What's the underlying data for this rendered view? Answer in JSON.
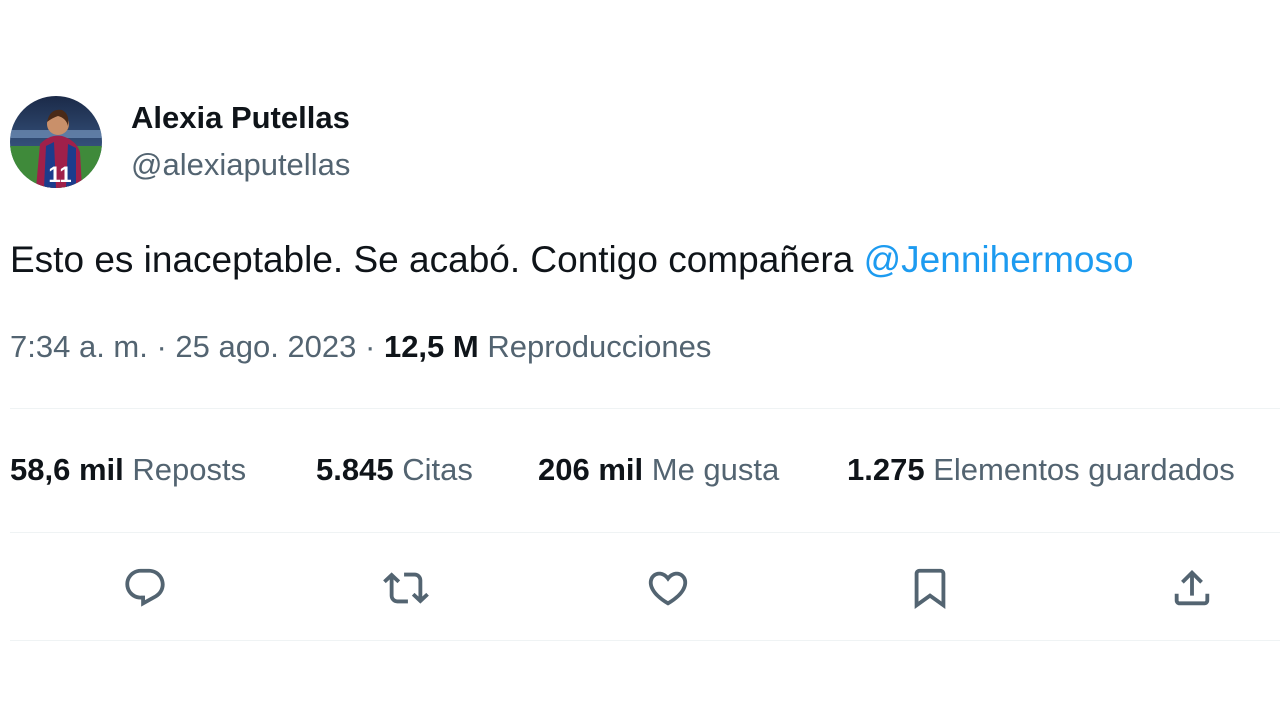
{
  "author": {
    "display_name": "Alexia Putellas",
    "handle": "@alexiaputellas",
    "avatar_icon": "avatar-photo"
  },
  "tweet": {
    "text": "Esto es inaceptable. Se acabó. Contigo compañera ",
    "mention": "@Jennihermoso",
    "time": "7:34 a. m. · 25 ago. 2023 · ",
    "views_count": "12,5 M",
    "views_label": " Reproducciones"
  },
  "stats": [
    {
      "count": "58,6 mil",
      "label": "Reposts"
    },
    {
      "count": "5.845",
      "label": "Citas"
    },
    {
      "count": "206 mil",
      "label": "Me gusta"
    },
    {
      "count": "1.275",
      "label": "Elementos guardados"
    }
  ],
  "actions": [
    {
      "icon": "reply-icon"
    },
    {
      "icon": "retweet-icon"
    },
    {
      "icon": "like-icon"
    },
    {
      "icon": "bookmark-icon"
    },
    {
      "icon": "share-icon"
    }
  ],
  "colors": {
    "text": "#0f1419",
    "secondary": "#536471",
    "link": "#1d9bf0",
    "divider": "#eff3f4"
  }
}
